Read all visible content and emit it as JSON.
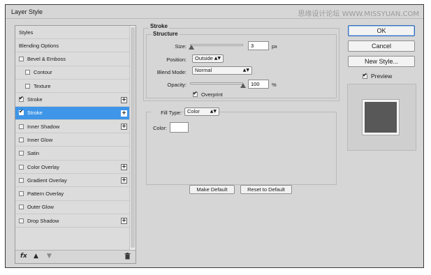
{
  "window": {
    "title": "Layer Style",
    "watermark": "思缘设计论坛 WWW.MISSYUAN.COM"
  },
  "styles_list": [
    {
      "label": "Styles",
      "checkbox": false,
      "checked": false,
      "plus": false,
      "selected": false,
      "indent": 0
    },
    {
      "label": "Blending Options",
      "checkbox": false,
      "checked": false,
      "plus": false,
      "selected": false,
      "indent": 0
    },
    {
      "label": "Bevel & Emboss",
      "checkbox": true,
      "checked": false,
      "plus": false,
      "selected": false,
      "indent": 0
    },
    {
      "label": "Contour",
      "checkbox": true,
      "checked": false,
      "plus": false,
      "selected": false,
      "indent": 1
    },
    {
      "label": "Texture",
      "checkbox": true,
      "checked": false,
      "plus": false,
      "selected": false,
      "indent": 1
    },
    {
      "label": "Stroke",
      "checkbox": true,
      "checked": true,
      "plus": true,
      "selected": false,
      "indent": 0
    },
    {
      "label": "Stroke",
      "checkbox": true,
      "checked": true,
      "plus": true,
      "selected": true,
      "indent": 0
    },
    {
      "label": "Inner Shadow",
      "checkbox": true,
      "checked": false,
      "plus": true,
      "selected": false,
      "indent": 0
    },
    {
      "label": "Inner Glow",
      "checkbox": true,
      "checked": false,
      "plus": false,
      "selected": false,
      "indent": 0
    },
    {
      "label": "Satin",
      "checkbox": true,
      "checked": false,
      "plus": false,
      "selected": false,
      "indent": 0
    },
    {
      "label": "Color Overlay",
      "checkbox": true,
      "checked": false,
      "plus": true,
      "selected": false,
      "indent": 0
    },
    {
      "label": "Gradient Overlay",
      "checkbox": true,
      "checked": false,
      "plus": true,
      "selected": false,
      "indent": 0
    },
    {
      "label": "Pattern Overlay",
      "checkbox": true,
      "checked": false,
      "plus": false,
      "selected": false,
      "indent": 0
    },
    {
      "label": "Outer Glow",
      "checkbox": true,
      "checked": false,
      "plus": false,
      "selected": false,
      "indent": 0
    },
    {
      "label": "Drop Shadow",
      "checkbox": true,
      "checked": false,
      "plus": true,
      "selected": false,
      "indent": 0
    }
  ],
  "bottom_icons": {
    "fx": "fx",
    "up": "▲",
    "down": "▼",
    "trash": "🗑"
  },
  "stroke": {
    "section_title": "Stroke",
    "structure_title": "Structure",
    "size_label": "Size:",
    "size_value": "3",
    "size_unit": "px",
    "size_fraction": 0.02,
    "position_label": "Position:",
    "position_value": "Outside",
    "blend_label": "Blend Mode:",
    "blend_value": "Normal",
    "opacity_label": "Opacity:",
    "opacity_value": "100",
    "opacity_unit": "%",
    "opacity_fraction": 1.0,
    "overprint_label": "Overprint",
    "overprint_checked": true,
    "fill_type_label": "Fill Type:",
    "fill_type_value": "Color",
    "color_label": "Color:",
    "color_value": "#ffffff",
    "make_default": "Make Default",
    "reset_default": "Reset to Default"
  },
  "buttons": {
    "ok": "OK",
    "cancel": "Cancel",
    "new_style": "New Style...",
    "preview_label": "Preview",
    "preview_checked": true
  },
  "colors": {
    "selected_row": "#3f95e8",
    "preview_swatch": "#585858"
  }
}
